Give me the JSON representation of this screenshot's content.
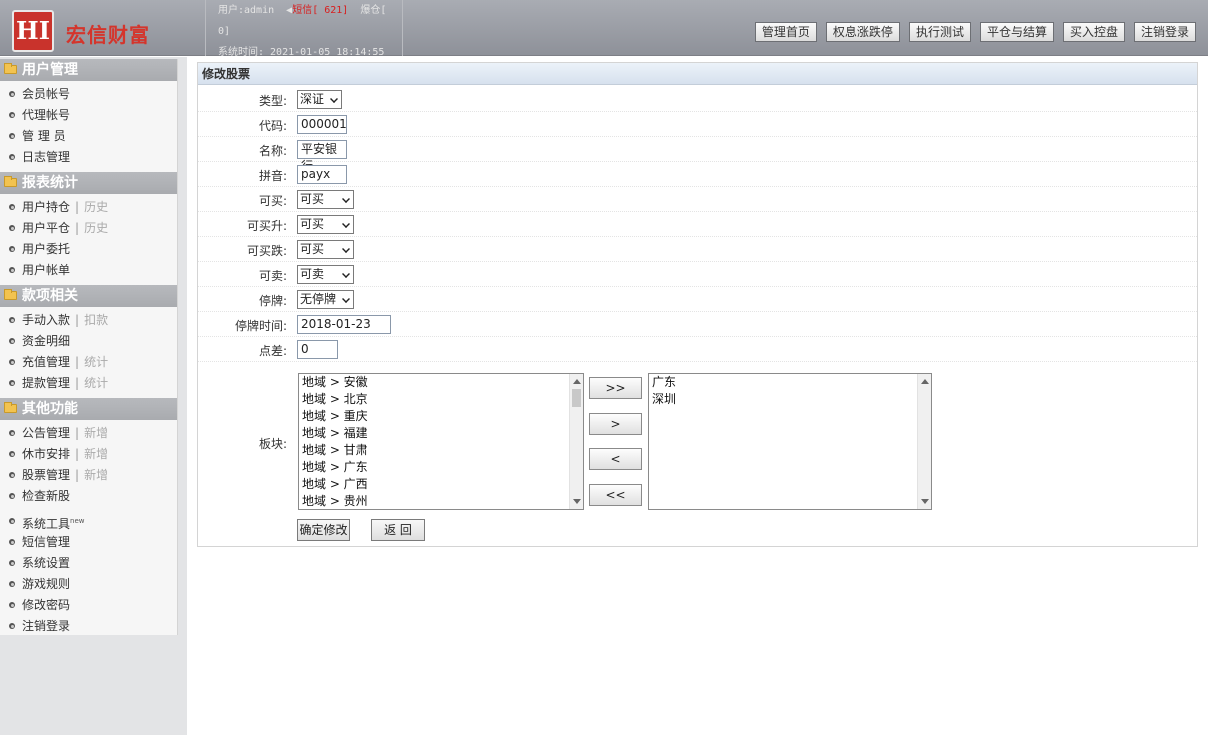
{
  "header": {
    "logo_mark": "HI",
    "app_name": "宏信财富",
    "user_label": "用户:admin",
    "sms_text": "短信[ 621]",
    "burst_text": "爆仓[",
    "burst_count": "0]",
    "system_time": "系统时间: 2021-01-05 18:14:55",
    "nav": [
      "管理首页",
      "权息涨跌停",
      "执行测试",
      "平仓与结算",
      "买入控盘",
      "注销登录"
    ]
  },
  "sidebar": {
    "sections": [
      {
        "title": "用户管理",
        "items": [
          {
            "label": "会员帐号"
          },
          {
            "label": "代理帐号"
          },
          {
            "label": "管 理 员"
          },
          {
            "label": "日志管理"
          }
        ]
      },
      {
        "title": "报表统计",
        "items": [
          {
            "label": "用户持仓",
            "sub": "历史"
          },
          {
            "label": "用户平仓",
            "sub": "历史"
          },
          {
            "label": "用户委托"
          },
          {
            "label": "用户帐单"
          }
        ]
      },
      {
        "title": "款项相关",
        "items": [
          {
            "label": "手动入款",
            "sub": "扣款"
          },
          {
            "label": "资金明细"
          },
          {
            "label": "充值管理",
            "sub": "统计"
          },
          {
            "label": "提款管理",
            "sub": "统计"
          }
        ]
      },
      {
        "title": "其他功能",
        "items": [
          {
            "label": "公告管理",
            "sub": "新增"
          },
          {
            "label": "休市安排",
            "sub": "新增"
          },
          {
            "label": "股票管理",
            "sub": "新增"
          },
          {
            "label": "检查新股"
          },
          {
            "label": "系统工具",
            "sup": "new"
          },
          {
            "label": "短信管理"
          },
          {
            "label": "系统设置"
          },
          {
            "label": "游戏规则"
          },
          {
            "label": "修改密码"
          },
          {
            "label": "注销登录"
          }
        ]
      }
    ]
  },
  "form": {
    "title": "修改股票",
    "type_label": "类型:",
    "type_value": "深证",
    "code_label": "代码:",
    "code_value": "000001",
    "name_label": "名称:",
    "name_value": "平安银行",
    "pinyin_label": "拼音:",
    "pinyin_value": "payx",
    "canbuy_label": "可买:",
    "canbuy_value": "可买",
    "canbuyup_label": "可买升:",
    "canbuyup_value": "可买",
    "canbuydown_label": "可买跌:",
    "canbuydown_value": "可买",
    "cansell_label": "可卖:",
    "cansell_value": "可卖",
    "suspend_label": "停牌:",
    "suspend_value": "无停牌",
    "suspend_time_label": "停牌时间:",
    "suspend_time_value": "2018-01-23",
    "spread_label": "点差:",
    "spread_value": "0",
    "sector_label": "板块:",
    "available_sectors": [
      "地域 > 安徽",
      "地域 > 北京",
      "地域 > 重庆",
      "地域 > 福建",
      "地域 > 甘肃",
      "地域 > 广东",
      "地域 > 广西",
      "地域 > 贵州"
    ],
    "selected_sectors": [
      "广东",
      "深圳"
    ],
    "move_buttons": [
      ">>",
      ">",
      "<",
      "<<"
    ],
    "submit_label": "确定修改",
    "back_label": "返 回"
  }
}
